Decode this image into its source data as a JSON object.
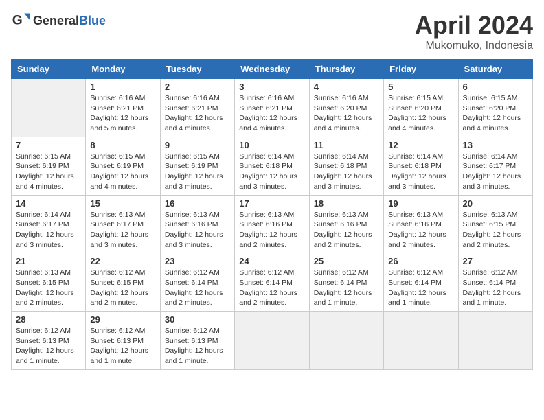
{
  "header": {
    "logo_general": "General",
    "logo_blue": "Blue",
    "month_title": "April 2024",
    "location": "Mukomuko, Indonesia"
  },
  "weekdays": [
    "Sunday",
    "Monday",
    "Tuesday",
    "Wednesday",
    "Thursday",
    "Friday",
    "Saturday"
  ],
  "weeks": [
    [
      {
        "day": "",
        "sunrise": "",
        "sunset": "",
        "daylight": "",
        "empty": true
      },
      {
        "day": "1",
        "sunrise": "Sunrise: 6:16 AM",
        "sunset": "Sunset: 6:21 PM",
        "daylight": "Daylight: 12 hours and 5 minutes."
      },
      {
        "day": "2",
        "sunrise": "Sunrise: 6:16 AM",
        "sunset": "Sunset: 6:21 PM",
        "daylight": "Daylight: 12 hours and 4 minutes."
      },
      {
        "day": "3",
        "sunrise": "Sunrise: 6:16 AM",
        "sunset": "Sunset: 6:21 PM",
        "daylight": "Daylight: 12 hours and 4 minutes."
      },
      {
        "day": "4",
        "sunrise": "Sunrise: 6:16 AM",
        "sunset": "Sunset: 6:20 PM",
        "daylight": "Daylight: 12 hours and 4 minutes."
      },
      {
        "day": "5",
        "sunrise": "Sunrise: 6:15 AM",
        "sunset": "Sunset: 6:20 PM",
        "daylight": "Daylight: 12 hours and 4 minutes."
      },
      {
        "day": "6",
        "sunrise": "Sunrise: 6:15 AM",
        "sunset": "Sunset: 6:20 PM",
        "daylight": "Daylight: 12 hours and 4 minutes."
      }
    ],
    [
      {
        "day": "7",
        "sunrise": "Sunrise: 6:15 AM",
        "sunset": "Sunset: 6:19 PM",
        "daylight": "Daylight: 12 hours and 4 minutes."
      },
      {
        "day": "8",
        "sunrise": "Sunrise: 6:15 AM",
        "sunset": "Sunset: 6:19 PM",
        "daylight": "Daylight: 12 hours and 4 minutes."
      },
      {
        "day": "9",
        "sunrise": "Sunrise: 6:15 AM",
        "sunset": "Sunset: 6:19 PM",
        "daylight": "Daylight: 12 hours and 3 minutes."
      },
      {
        "day": "10",
        "sunrise": "Sunrise: 6:14 AM",
        "sunset": "Sunset: 6:18 PM",
        "daylight": "Daylight: 12 hours and 3 minutes."
      },
      {
        "day": "11",
        "sunrise": "Sunrise: 6:14 AM",
        "sunset": "Sunset: 6:18 PM",
        "daylight": "Daylight: 12 hours and 3 minutes."
      },
      {
        "day": "12",
        "sunrise": "Sunrise: 6:14 AM",
        "sunset": "Sunset: 6:18 PM",
        "daylight": "Daylight: 12 hours and 3 minutes."
      },
      {
        "day": "13",
        "sunrise": "Sunrise: 6:14 AM",
        "sunset": "Sunset: 6:17 PM",
        "daylight": "Daylight: 12 hours and 3 minutes."
      }
    ],
    [
      {
        "day": "14",
        "sunrise": "Sunrise: 6:14 AM",
        "sunset": "Sunset: 6:17 PM",
        "daylight": "Daylight: 12 hours and 3 minutes."
      },
      {
        "day": "15",
        "sunrise": "Sunrise: 6:13 AM",
        "sunset": "Sunset: 6:17 PM",
        "daylight": "Daylight: 12 hours and 3 minutes."
      },
      {
        "day": "16",
        "sunrise": "Sunrise: 6:13 AM",
        "sunset": "Sunset: 6:16 PM",
        "daylight": "Daylight: 12 hours and 3 minutes."
      },
      {
        "day": "17",
        "sunrise": "Sunrise: 6:13 AM",
        "sunset": "Sunset: 6:16 PM",
        "daylight": "Daylight: 12 hours and 2 minutes."
      },
      {
        "day": "18",
        "sunrise": "Sunrise: 6:13 AM",
        "sunset": "Sunset: 6:16 PM",
        "daylight": "Daylight: 12 hours and 2 minutes."
      },
      {
        "day": "19",
        "sunrise": "Sunrise: 6:13 AM",
        "sunset": "Sunset: 6:16 PM",
        "daylight": "Daylight: 12 hours and 2 minutes."
      },
      {
        "day": "20",
        "sunrise": "Sunrise: 6:13 AM",
        "sunset": "Sunset: 6:15 PM",
        "daylight": "Daylight: 12 hours and 2 minutes."
      }
    ],
    [
      {
        "day": "21",
        "sunrise": "Sunrise: 6:13 AM",
        "sunset": "Sunset: 6:15 PM",
        "daylight": "Daylight: 12 hours and 2 minutes."
      },
      {
        "day": "22",
        "sunrise": "Sunrise: 6:12 AM",
        "sunset": "Sunset: 6:15 PM",
        "daylight": "Daylight: 12 hours and 2 minutes."
      },
      {
        "day": "23",
        "sunrise": "Sunrise: 6:12 AM",
        "sunset": "Sunset: 6:14 PM",
        "daylight": "Daylight: 12 hours and 2 minutes."
      },
      {
        "day": "24",
        "sunrise": "Sunrise: 6:12 AM",
        "sunset": "Sunset: 6:14 PM",
        "daylight": "Daylight: 12 hours and 2 minutes."
      },
      {
        "day": "25",
        "sunrise": "Sunrise: 6:12 AM",
        "sunset": "Sunset: 6:14 PM",
        "daylight": "Daylight: 12 hours and 1 minute."
      },
      {
        "day": "26",
        "sunrise": "Sunrise: 6:12 AM",
        "sunset": "Sunset: 6:14 PM",
        "daylight": "Daylight: 12 hours and 1 minute."
      },
      {
        "day": "27",
        "sunrise": "Sunrise: 6:12 AM",
        "sunset": "Sunset: 6:14 PM",
        "daylight": "Daylight: 12 hours and 1 minute."
      }
    ],
    [
      {
        "day": "28",
        "sunrise": "Sunrise: 6:12 AM",
        "sunset": "Sunset: 6:13 PM",
        "daylight": "Daylight: 12 hours and 1 minute."
      },
      {
        "day": "29",
        "sunrise": "Sunrise: 6:12 AM",
        "sunset": "Sunset: 6:13 PM",
        "daylight": "Daylight: 12 hours and 1 minute."
      },
      {
        "day": "30",
        "sunrise": "Sunrise: 6:12 AM",
        "sunset": "Sunset: 6:13 PM",
        "daylight": "Daylight: 12 hours and 1 minute."
      },
      {
        "day": "",
        "sunrise": "",
        "sunset": "",
        "daylight": "",
        "empty": true
      },
      {
        "day": "",
        "sunrise": "",
        "sunset": "",
        "daylight": "",
        "empty": true
      },
      {
        "day": "",
        "sunrise": "",
        "sunset": "",
        "daylight": "",
        "empty": true
      },
      {
        "day": "",
        "sunrise": "",
        "sunset": "",
        "daylight": "",
        "empty": true
      }
    ]
  ]
}
